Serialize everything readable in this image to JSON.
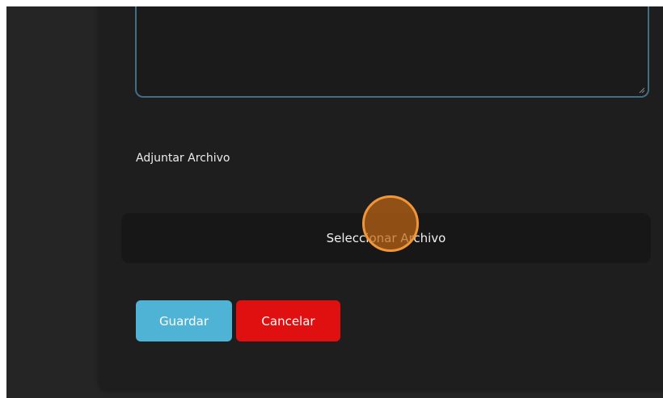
{
  "form": {
    "attachment_label": "Adjuntar Archivo",
    "select_file_label": "Seleccionar Archivo",
    "save_label": "Guardar",
    "cancel_label": "Cancelar",
    "description_value": ""
  },
  "colors": {
    "page_background": "#252525",
    "card_background": "#1e1e1e",
    "textarea_border": "#3f6f86",
    "save_button": "#4fb3d5",
    "cancel_button": "#e01010",
    "click_indicator": "#f0963a"
  },
  "icons": {
    "resize_handle": "resize-handle-icon"
  }
}
